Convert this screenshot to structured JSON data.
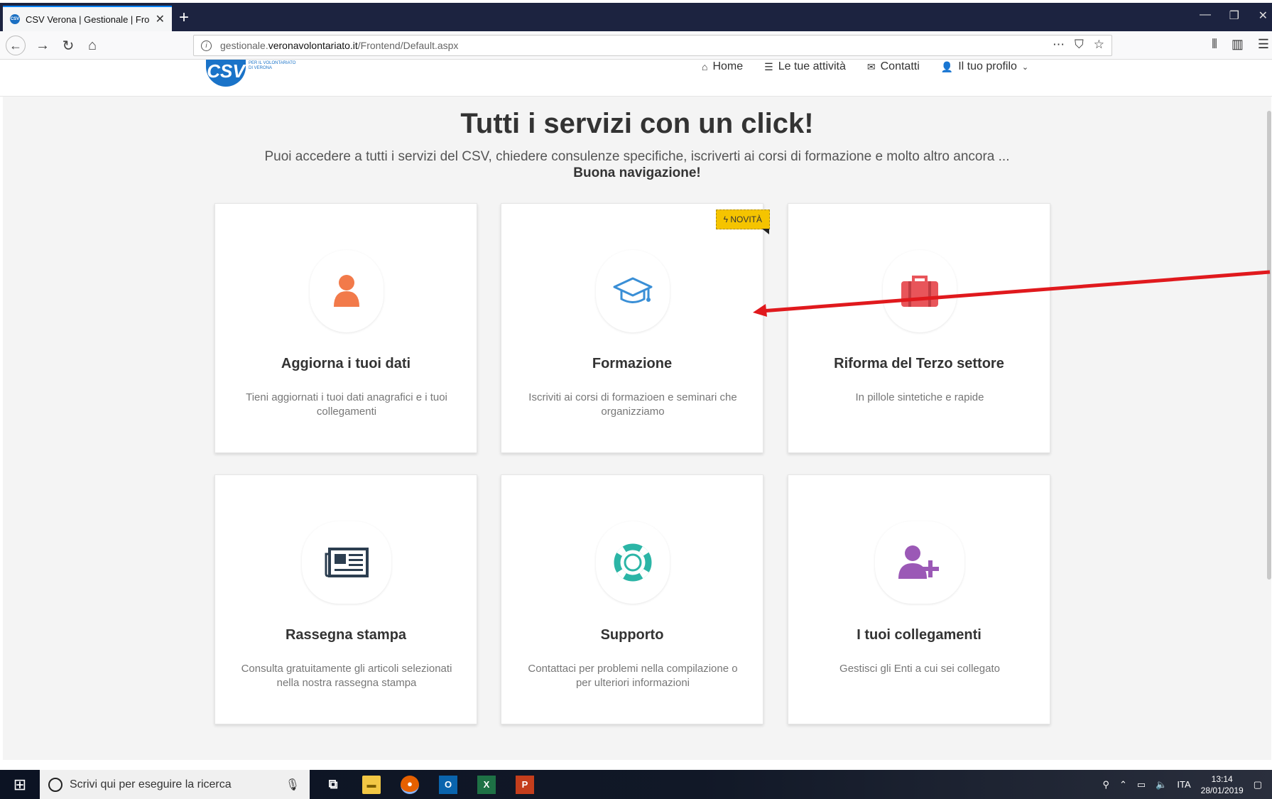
{
  "browser": {
    "tab_title": "CSV Verona | Gestionale | Fronte",
    "url_prefix": "gestionale.",
    "url_domain": "veronavolontariato.it",
    "url_path": "/Frontend/Default.aspx"
  },
  "site": {
    "logo_abbr": "CSV",
    "logo_line1": "PER IL VOLONTARIATO",
    "logo_line2": "DI VERONA",
    "menu": [
      {
        "label": "Home",
        "icon": "home-icon"
      },
      {
        "label": "Le tue attività",
        "icon": "list-icon"
      },
      {
        "label": "Contatti",
        "icon": "envelope-icon"
      },
      {
        "label": "Il tuo profilo",
        "icon": "user-icon"
      }
    ]
  },
  "hero": {
    "title": "Tutti i servizi con un click!",
    "subtitle": "Puoi accedere a tutti i servizi del CSV, chiedere consulenze specifiche, iscriverti ai corsi di formazione e molto altro ancora ...",
    "subtitle_bold": "Buona navigazione!"
  },
  "cards": [
    {
      "title": "Aggiorna i tuoi dati",
      "desc": "Tieni aggiornati i tuoi dati anagrafici e i tuoi collegamenti",
      "icon": "person-icon",
      "color": "#f27a4a"
    },
    {
      "title": "Formazione",
      "desc": "Iscriviti ai corsi di formazioen e seminari che organizziamo",
      "icon": "graduation-cap-icon",
      "color": "#3a8fd6",
      "badge": "NOVITÀ"
    },
    {
      "title": "Riforma del Terzo settore",
      "desc": "In pillole sintetiche e rapide",
      "icon": "briefcase-icon",
      "color": "#e8555a"
    },
    {
      "title": "Rassegna stampa",
      "desc": "Consulta gratuitamente gli articoli selezionati nella nostra rassegna stampa",
      "icon": "newspaper-icon",
      "color": "#2c3e50"
    },
    {
      "title": "Supporto",
      "desc": "Contattaci per problemi nella compilazione o per ulteriori informazioni",
      "icon": "lifebuoy-icon",
      "color": "#2bb5a6"
    },
    {
      "title": "I tuoi collegamenti",
      "desc": "Gestisci gli Enti a cui sei collegato",
      "icon": "add-user-icon",
      "color": "#9b59b6"
    }
  ],
  "taskbar": {
    "search_placeholder": "Scrivi qui per eseguire la ricerca",
    "language": "ITA",
    "time": "13:14",
    "date": "28/01/2019"
  }
}
